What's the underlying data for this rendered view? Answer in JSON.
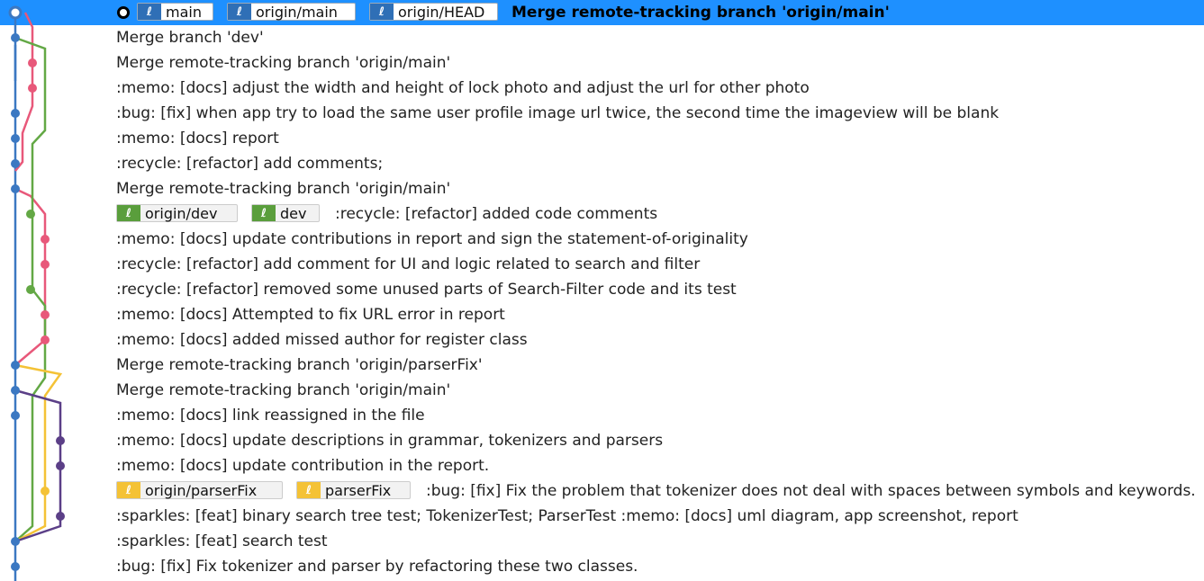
{
  "colors": {
    "selection": "#1e90ff",
    "lane_blue": "#3b78c2",
    "lane_pink": "#e8587a",
    "lane_green": "#63a845",
    "lane_yellow": "#f4c236",
    "lane_purple": "#5b3f87"
  },
  "rows": [
    {
      "message": "Merge remote-tracking branch 'origin/main'",
      "selected": true,
      "head": true,
      "refs": [
        {
          "label": "main",
          "color": "blue",
          "icon": "branch-icon"
        },
        {
          "label": "origin/main",
          "color": "blue",
          "icon": "branch-icon"
        },
        {
          "label": "origin/HEAD",
          "color": "blue",
          "icon": "branch-icon"
        }
      ]
    },
    {
      "message": "Merge branch 'dev'"
    },
    {
      "message": "Merge remote-tracking branch 'origin/main'"
    },
    {
      "message": ":memo: [docs] adjust the width and height of lock photo and adjust the url for other photo"
    },
    {
      "message": ":bug: [fix] when app try to load the same user profile image url twice, the second time the imageview will be blank"
    },
    {
      "message": ":memo: [docs] report"
    },
    {
      "message": ":recycle: [refactor] add comments;"
    },
    {
      "message": "Merge remote-tracking branch 'origin/main'"
    },
    {
      "message": ":recycle: [refactor] added code comments",
      "refs": [
        {
          "label": "origin/dev",
          "color": "green",
          "icon": "branch-icon"
        },
        {
          "label": "dev",
          "color": "green",
          "icon": "branch-icon"
        }
      ]
    },
    {
      "message": ":memo: [docs] update contributions in report and sign the statement-of-originality"
    },
    {
      "message": ":recycle: [refactor] add comment for UI and logic related to search and filter"
    },
    {
      "message": ":recycle: [refactor] removed some unused parts of Search-Filter code and its test"
    },
    {
      "message": ":memo: [docs] Attempted to fix URL error in report"
    },
    {
      "message": ":memo: [docs] added missed author for register  class"
    },
    {
      "message": "Merge remote-tracking branch 'origin/parserFix'"
    },
    {
      "message": "Merge remote-tracking branch 'origin/main'"
    },
    {
      "message": ":memo: [docs] link reassigned in the file"
    },
    {
      "message": ":memo: [docs] update descriptions in grammar, tokenizers and parsers"
    },
    {
      "message": ":memo: [docs] update contribution in the report."
    },
    {
      "message": ":bug: [fix] Fix the problem that tokenizer does not deal with spaces between symbols and keywords.",
      "refs": [
        {
          "label": "origin/parserFix",
          "color": "yellow",
          "icon": "branch-icon"
        },
        {
          "label": "parserFix",
          "color": "yellow",
          "icon": "branch-icon"
        }
      ]
    },
    {
      "message": ":sparkles: [feat] binary search tree test; TokenizerTest; ParserTest :memo: [docs] uml diagram, app screenshot, report"
    },
    {
      "message": ":sparkles: [feat] search test"
    },
    {
      "message": ":bug: [fix] Fix tokenizer and parser by refactoring these two classes."
    }
  ]
}
